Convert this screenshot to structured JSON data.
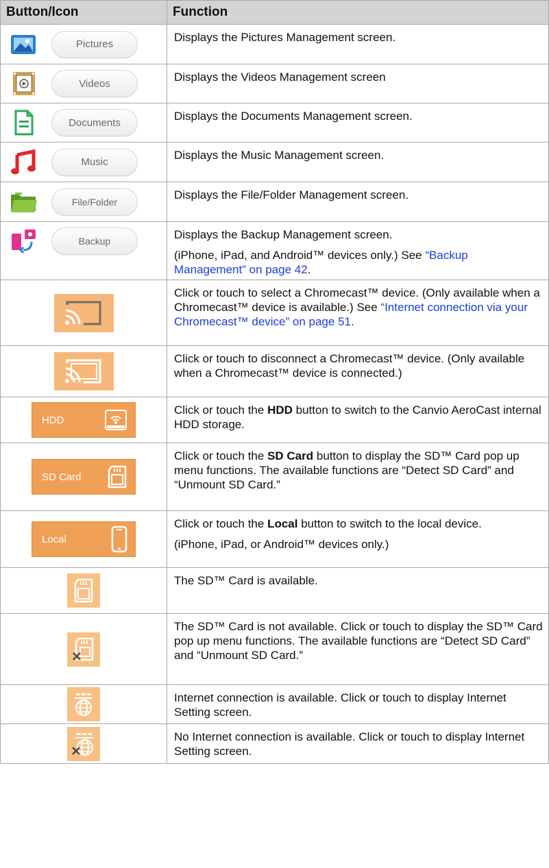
{
  "header": {
    "col1": "Button/Icon",
    "col2": "Function"
  },
  "rows": [
    {
      "icon": "pictures-icon",
      "button": "Pictures",
      "desc": "Displays the Pictures Management screen."
    },
    {
      "icon": "videos-icon",
      "button": "Videos",
      "desc": "Displays the Videos Management screen"
    },
    {
      "icon": "documents-icon",
      "button": "Documents",
      "desc": "Displays the Documents Management screen."
    },
    {
      "icon": "music-icon",
      "button": "Music",
      "desc": "Displays the Music Management screen."
    },
    {
      "icon": "file-folder-icon",
      "button": "File/Folder",
      "desc": "Displays the File/Folder Management screen."
    },
    {
      "icon": "backup-icon",
      "button": "Backup",
      "desc": "Displays the Backup Management screen.",
      "desc2_pre": "(iPhone, iPad, and Android™ devices only.) See ",
      "desc2_link": "“Backup Management” on page 42",
      "desc2_post": "."
    },
    {
      "icon": "chromecast-cast-icon",
      "desc_pre": "Click or touch to select a Chromecast™ device. (Only available when a Chromecast™ device is available.) See ",
      "desc_link": "“Internet connection via your Chromecast™ device” on page 51",
      "desc_post": "."
    },
    {
      "icon": "chromecast-connected-icon",
      "desc": "Click or touch to disconnect a Chromecast™ device. (Only available when a Chromecast™ device is connected.)"
    },
    {
      "icon": "hdd-icon",
      "button": "HDD",
      "desc_pre": "Click or touch the ",
      "desc_bold": "HDD",
      "desc_post": " button to switch to the Canvio AeroCast internal HDD storage."
    },
    {
      "icon": "sd-card-icon",
      "button": "SD Card",
      "desc_pre": "Click or touch the ",
      "desc_bold": "SD Card",
      "desc_post": " button to display the SD™ Card pop up menu functions. The available functions are “Detect SD Card” and “Unmount SD Card.”"
    },
    {
      "icon": "phone-icon",
      "button": "Local",
      "desc_pre": "Click or touch the ",
      "desc_bold": "Local",
      "desc_post": " button to switch to the local device.",
      "desc2": "(iPhone, iPad, or Android™ devices only.)"
    },
    {
      "icon": "sd-available-icon",
      "desc": "The SD™ Card is available."
    },
    {
      "icon": "sd-unavailable-icon",
      "desc": "The SD™ Card is not available. Click or touch to display the SD™ Card pop up menu functions. The available functions are “Detect SD Card” and “Unmount SD Card.”"
    },
    {
      "icon": "internet-available-icon",
      "desc": "Internet connection is available. Click or touch to display Internet Setting screen."
    },
    {
      "icon": "internet-unavailable-icon",
      "desc": "No Internet connection is available. Click or touch to display Internet Setting screen."
    }
  ],
  "colors": {
    "header_bg": "#d3d3d3",
    "orange": "#f0a056",
    "link": "#1a3fd6"
  }
}
